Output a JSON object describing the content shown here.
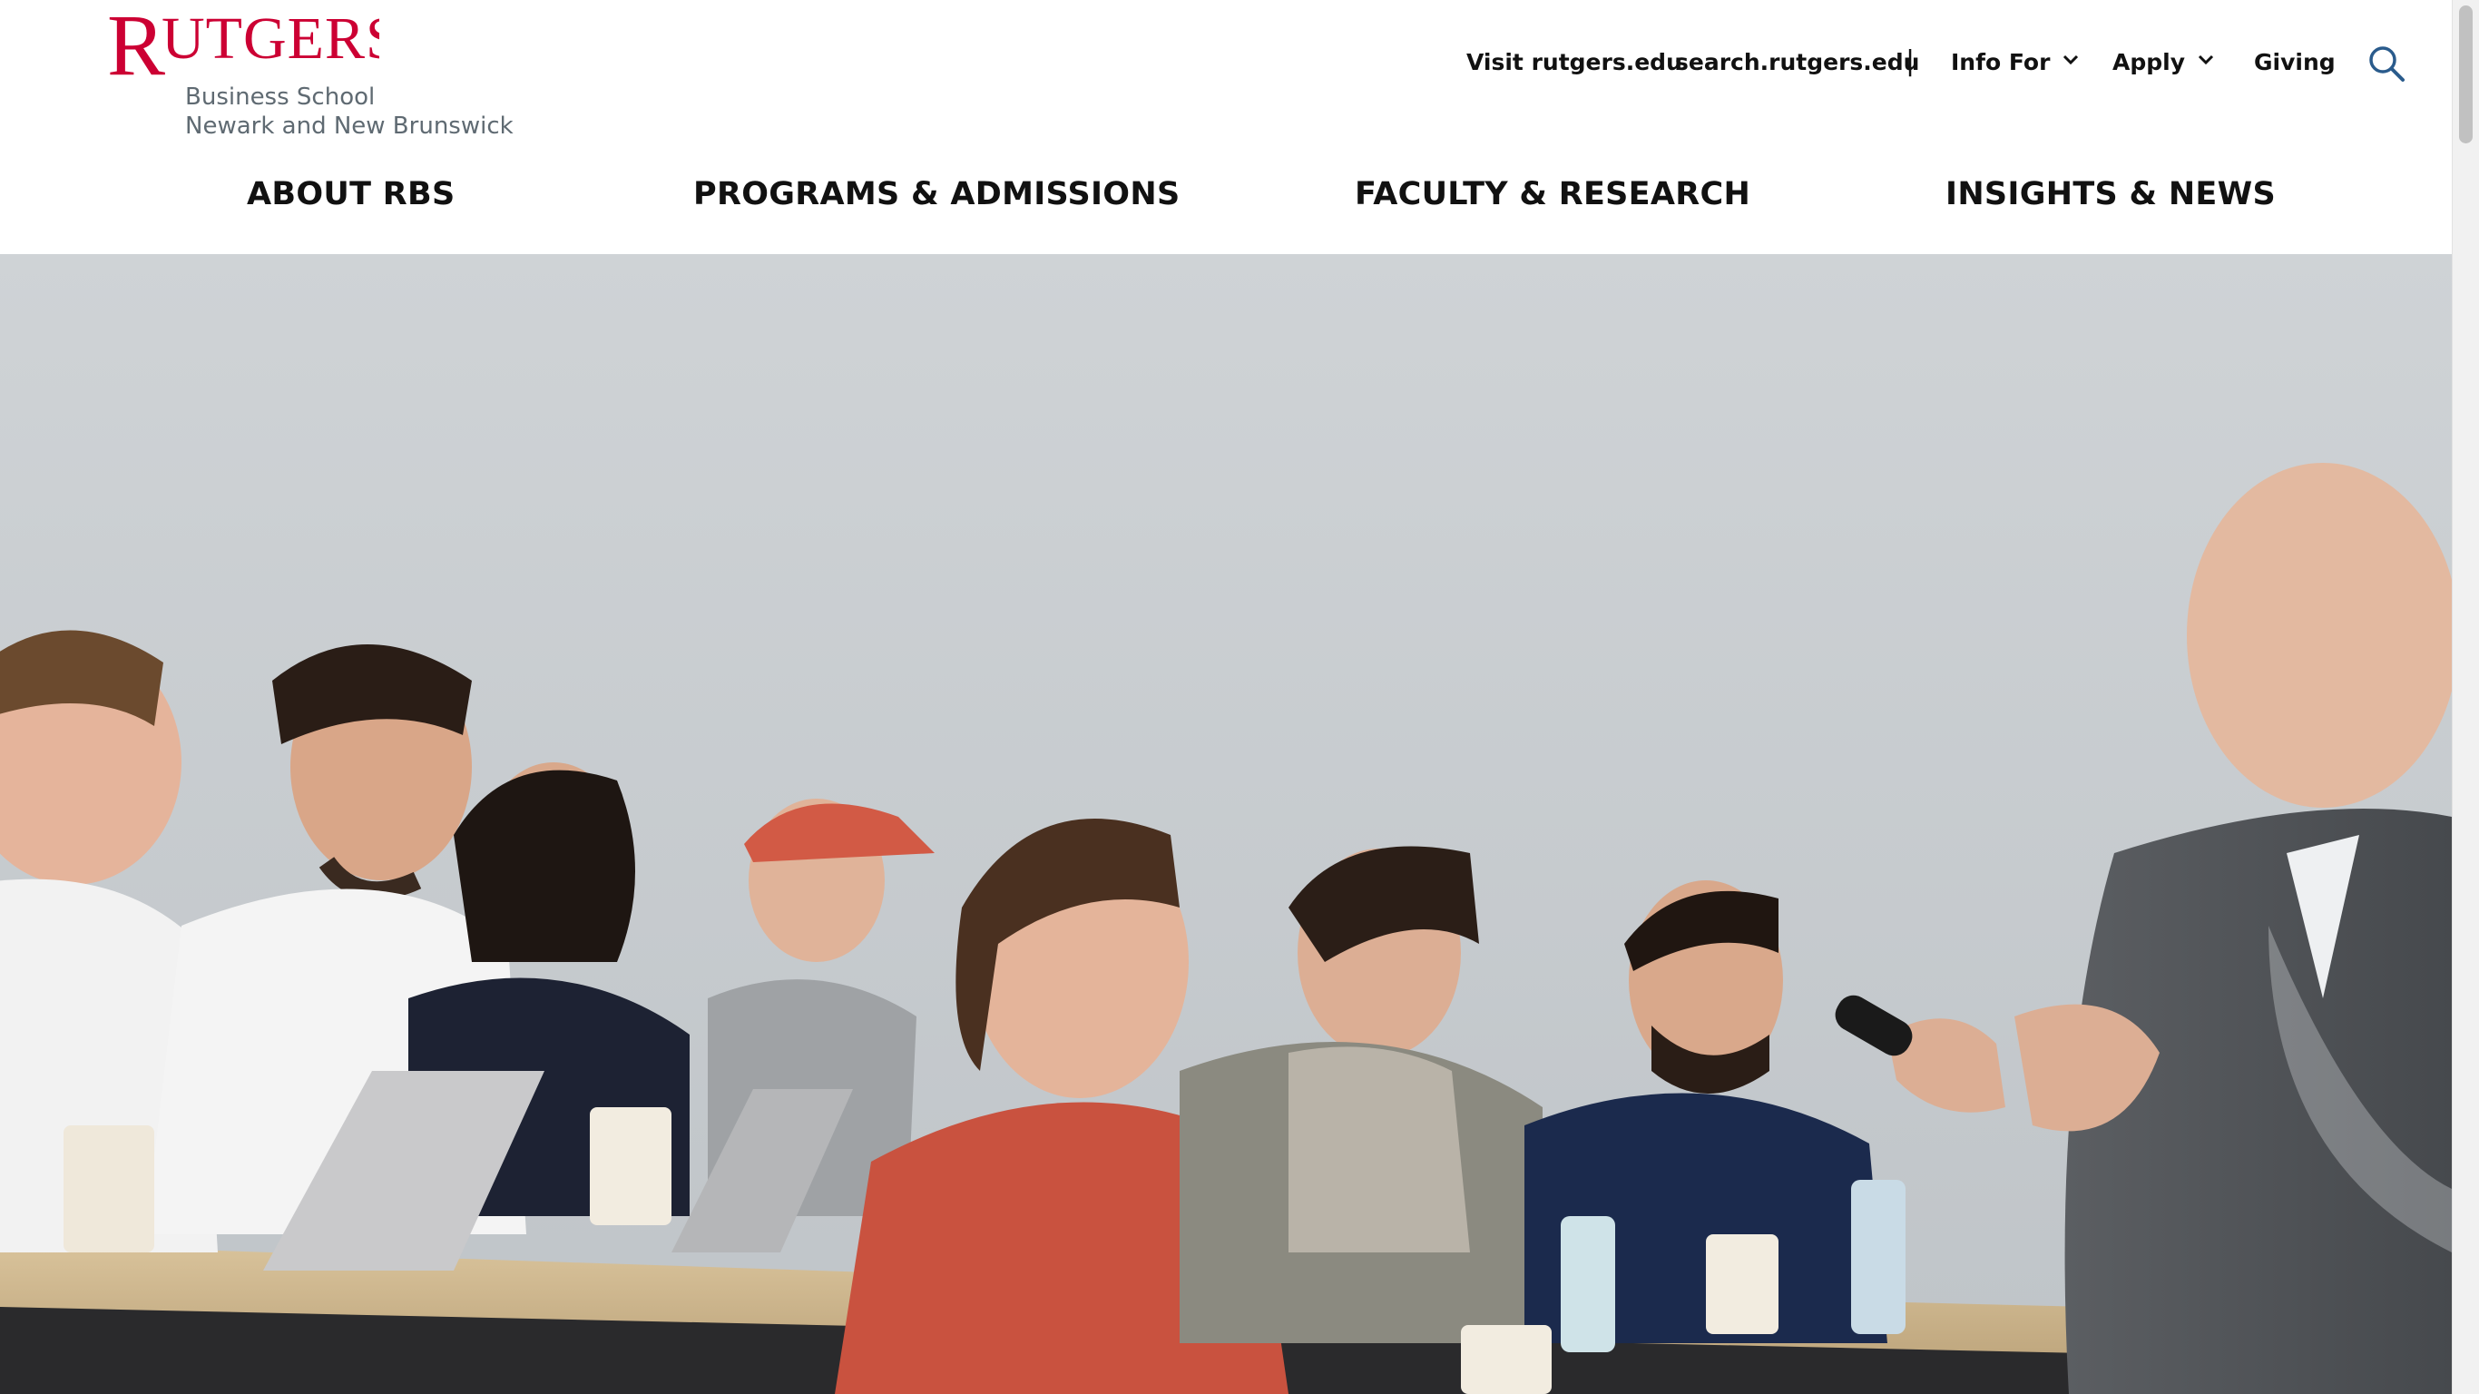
{
  "brand": {
    "wordmark": "RUTGERS",
    "subtitle_line1": "Business School",
    "subtitle_line2": "Newark and New Brunswick",
    "color": "#cc0033"
  },
  "utility_nav": {
    "visit": "Visit rutgers.edu",
    "search_site": "search.rutgers.edu",
    "divider": "|",
    "info_for": "Info For",
    "apply": "Apply",
    "giving": "Giving",
    "search_icon": "search-icon"
  },
  "main_nav": {
    "items": [
      "ABOUT RBS",
      "PROGRAMS & ADMISSIONS",
      "FACULTY & RESEARCH",
      "INSIGHTS & NEWS"
    ]
  },
  "hero": {
    "description": "classroom-photo"
  }
}
